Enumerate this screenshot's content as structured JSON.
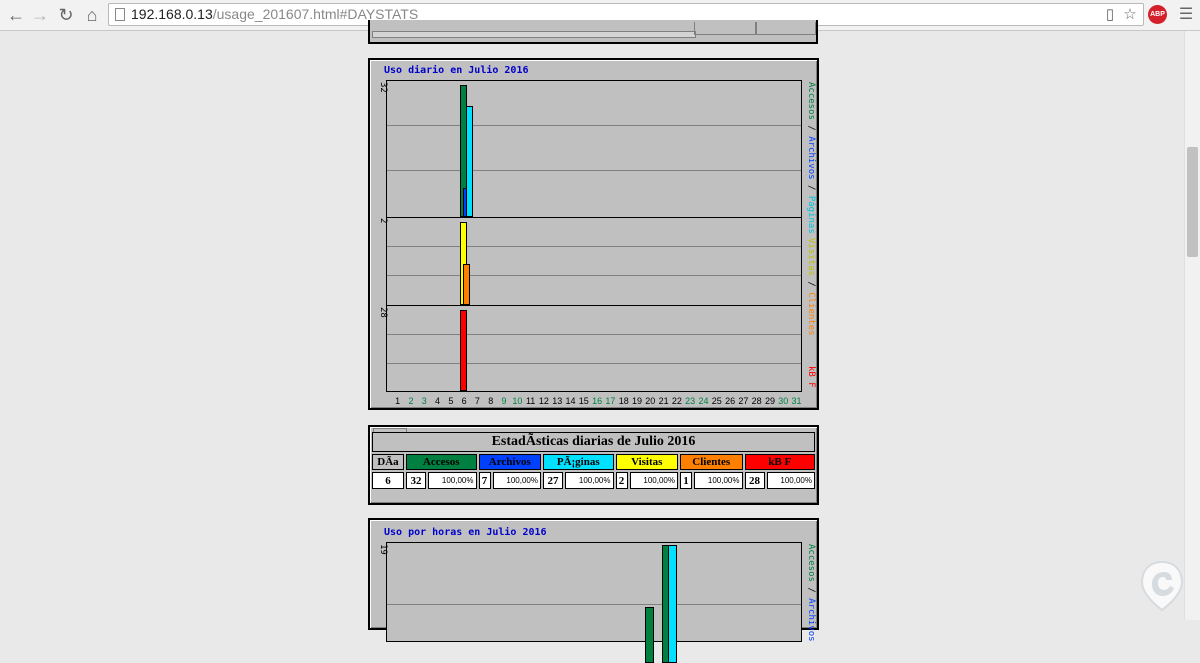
{
  "browser": {
    "url_host": "192.168.0.13",
    "url_path": "/usage_201607.html#DAYSTATS",
    "abp_label": "ABP"
  },
  "daily_graph": {
    "title": "Uso diario en Julio 2016",
    "y_max_hits": "32",
    "y_max_visits": "2",
    "y_max_kb": "28",
    "legend_accesos": "Accesos",
    "legend_archivos": "Archivos",
    "legend_paginas": "Páginas",
    "legend_visitas": "Visitas",
    "legend_clientes": "Clientes",
    "legend_kbf": "kB F",
    "legend_sep": "/",
    "days": [
      "1",
      "2",
      "3",
      "4",
      "5",
      "6",
      "7",
      "8",
      "9",
      "10",
      "11",
      "12",
      "13",
      "14",
      "15",
      "16",
      "17",
      "18",
      "19",
      "20",
      "21",
      "22",
      "23",
      "24",
      "25",
      "26",
      "27",
      "28",
      "29",
      "30",
      "31"
    ],
    "weekend_days": [
      "2",
      "3",
      "9",
      "10",
      "16",
      "17",
      "23",
      "24",
      "30",
      "31"
    ]
  },
  "stats_table": {
    "title": "EstadÃsticas diarias de Julio 2016",
    "headers": {
      "dia": "DÃa",
      "accesos": "Accesos",
      "archivos": "Archivos",
      "paginas": "PÃ¡ginas",
      "visitas": "Visitas",
      "clientes": "Clientes",
      "kbf": "kB F"
    },
    "row": {
      "dia": "6",
      "accesos": "32",
      "accesos_pct": "100,00%",
      "archivos": "7",
      "archivos_pct": "100,00%",
      "paginas": "27",
      "paginas_pct": "100,00%",
      "visitas": "2",
      "visitas_pct": "100,00%",
      "clientes": "1",
      "clientes_pct": "100,00%",
      "kbf": "28",
      "kbf_pct": "100,00%"
    }
  },
  "hourly_graph": {
    "title": "Uso por horas en Julio 2016",
    "y_max": "19",
    "legend_accesos": "Accesos",
    "legend_archivos": "Archivos"
  },
  "colors": {
    "accesos": "#008040",
    "archivos": "#0040ff",
    "paginas": "#00e0ff",
    "visitas": "#ffff00",
    "clientes": "#ff8000",
    "kbf": "#ff0000"
  },
  "chart_data": [
    {
      "type": "bar",
      "title": "Uso diario en Julio 2016",
      "categories": [
        "1",
        "2",
        "3",
        "4",
        "5",
        "6",
        "7",
        "8",
        "9",
        "10",
        "11",
        "12",
        "13",
        "14",
        "15",
        "16",
        "17",
        "18",
        "19",
        "20",
        "21",
        "22",
        "23",
        "24",
        "25",
        "26",
        "27",
        "28",
        "29",
        "30",
        "31"
      ],
      "series": [
        {
          "name": "Accesos",
          "panel": "top",
          "values": [
            0,
            0,
            0,
            0,
            0,
            32,
            0,
            0,
            0,
            0,
            0,
            0,
            0,
            0,
            0,
            0,
            0,
            0,
            0,
            0,
            0,
            0,
            0,
            0,
            0,
            0,
            0,
            0,
            0,
            0,
            0
          ]
        },
        {
          "name": "Archivos",
          "panel": "top",
          "values": [
            0,
            0,
            0,
            0,
            0,
            7,
            0,
            0,
            0,
            0,
            0,
            0,
            0,
            0,
            0,
            0,
            0,
            0,
            0,
            0,
            0,
            0,
            0,
            0,
            0,
            0,
            0,
            0,
            0,
            0,
            0
          ]
        },
        {
          "name": "Páginas",
          "panel": "top",
          "values": [
            0,
            0,
            0,
            0,
            0,
            27,
            0,
            0,
            0,
            0,
            0,
            0,
            0,
            0,
            0,
            0,
            0,
            0,
            0,
            0,
            0,
            0,
            0,
            0,
            0,
            0,
            0,
            0,
            0,
            0,
            0
          ]
        },
        {
          "name": "Visitas",
          "panel": "middle",
          "values": [
            0,
            0,
            0,
            0,
            0,
            2,
            0,
            0,
            0,
            0,
            0,
            0,
            0,
            0,
            0,
            0,
            0,
            0,
            0,
            0,
            0,
            0,
            0,
            0,
            0,
            0,
            0,
            0,
            0,
            0,
            0
          ]
        },
        {
          "name": "Clientes",
          "panel": "middle",
          "values": [
            0,
            0,
            0,
            0,
            0,
            1,
            0,
            0,
            0,
            0,
            0,
            0,
            0,
            0,
            0,
            0,
            0,
            0,
            0,
            0,
            0,
            0,
            0,
            0,
            0,
            0,
            0,
            0,
            0,
            0,
            0
          ]
        },
        {
          "name": "kB F",
          "panel": "bottom",
          "values": [
            0,
            0,
            0,
            0,
            0,
            28,
            0,
            0,
            0,
            0,
            0,
            0,
            0,
            0,
            0,
            0,
            0,
            0,
            0,
            0,
            0,
            0,
            0,
            0,
            0,
            0,
            0,
            0,
            0,
            0,
            0
          ]
        }
      ],
      "ylim_top": [
        0,
        32
      ],
      "ylim_middle": [
        0,
        2
      ],
      "ylim_bottom": [
        0,
        28
      ],
      "grid": true
    },
    {
      "type": "bar",
      "title": "Uso por horas en Julio 2016",
      "series": [
        {
          "name": "Accesos",
          "visible_values_estimated": [
            7,
            19
          ]
        },
        {
          "name": "Archivos",
          "visible_values_estimated": [
            19
          ]
        }
      ],
      "ylim": [
        0,
        19
      ],
      "grid": true
    }
  ]
}
